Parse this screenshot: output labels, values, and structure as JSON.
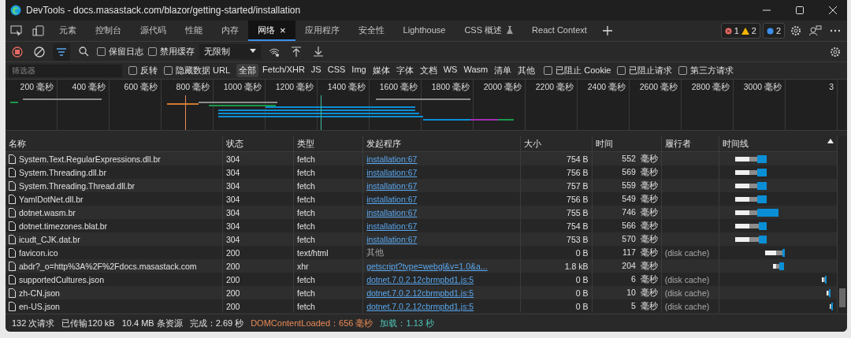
{
  "window": {
    "title": "DevTools - docs.masastack.com/blazor/getting-started/installation"
  },
  "tabs": [
    {
      "label": "元素",
      "selected": false
    },
    {
      "label": "控制台",
      "selected": false
    },
    {
      "label": "源代码",
      "selected": false
    },
    {
      "label": "性能",
      "selected": false
    },
    {
      "label": "内存",
      "selected": false
    },
    {
      "label": "网络",
      "selected": true,
      "close": "×"
    },
    {
      "label": "应用程序",
      "selected": false
    },
    {
      "label": "安全性",
      "selected": false
    },
    {
      "label": "Lighthouse",
      "selected": false
    },
    {
      "label": "CSS 概述",
      "selected": false,
      "experimental": true
    },
    {
      "label": "React Context",
      "selected": false
    }
  ],
  "issues": {
    "errors": "1",
    "warnings": "2",
    "info": "2"
  },
  "toolbar": {
    "recording": true,
    "filter_active": true,
    "preserve_log": {
      "label": "保留日志",
      "checked": false
    },
    "disable_cache": {
      "label": "禁用缓存",
      "checked": false
    },
    "throttle": "无限制"
  },
  "filter_bar": {
    "placeholder": "筛选器",
    "invert": {
      "label": "反转",
      "checked": false
    },
    "hide_data_urls": {
      "label": "隐藏数据 URL",
      "checked": false
    },
    "types": [
      {
        "label": "全部",
        "selected": true
      },
      {
        "label": "Fetch/XHR",
        "selected": false
      },
      {
        "label": "JS",
        "selected": false
      },
      {
        "label": "CSS",
        "selected": false
      },
      {
        "label": "Img",
        "selected": false
      },
      {
        "label": "媒体",
        "selected": false
      },
      {
        "label": "字体",
        "selected": false
      },
      {
        "label": "文档",
        "selected": false
      },
      {
        "label": "WS",
        "selected": false
      },
      {
        "label": "Wasm",
        "selected": false
      },
      {
        "label": "清单",
        "selected": false
      },
      {
        "label": "其他",
        "selected": false
      }
    ],
    "extra": [
      {
        "label": "已阻止 Cookie",
        "checked": false
      },
      {
        "label": "已阻止请求",
        "checked": false
      },
      {
        "label": "第三方请求",
        "checked": false
      }
    ]
  },
  "overview": {
    "ticks": [
      "200 毫秒",
      "400 毫秒",
      "600 毫秒",
      "800 毫秒",
      "1000 毫秒",
      "1200 毫秒",
      "1400 毫秒",
      "1600 毫秒",
      "1800 毫秒",
      "2000 毫秒",
      "2200 毫秒",
      "2400 毫秒",
      "2600 毫秒",
      "2800 毫秒",
      "3000 毫秒",
      "3"
    ]
  },
  "table": {
    "columns": [
      "名称",
      "状态",
      "类型",
      "发起程序",
      "大小",
      "时间",
      "履行者",
      "时间线"
    ],
    "rows": [
      {
        "name": "System.Text.RegularExpressions.dll.br",
        "status": "304",
        "type": "fetch",
        "initiator": "installation:67",
        "initiator_link": true,
        "size": "754 B",
        "time": "552",
        "unit": "毫秒",
        "fulfilled_by": ""
      },
      {
        "name": "System.Threading.dll.br",
        "status": "304",
        "type": "fetch",
        "initiator": "installation:67",
        "initiator_link": true,
        "size": "756 B",
        "time": "569",
        "unit": "毫秒",
        "fulfilled_by": ""
      },
      {
        "name": "System.Threading.Thread.dll.br",
        "status": "304",
        "type": "fetch",
        "initiator": "installation:67",
        "initiator_link": true,
        "size": "757 B",
        "time": "559",
        "unit": "毫秒",
        "fulfilled_by": ""
      },
      {
        "name": "YamlDotNet.dll.br",
        "status": "304",
        "type": "fetch",
        "initiator": "installation:67",
        "initiator_link": true,
        "size": "756 B",
        "time": "549",
        "unit": "毫秒",
        "fulfilled_by": ""
      },
      {
        "name": "dotnet.wasm.br",
        "status": "304",
        "type": "fetch",
        "initiator": "installation:67",
        "initiator_link": true,
        "size": "755 B",
        "time": "746",
        "unit": "毫秒",
        "fulfilled_by": ""
      },
      {
        "name": "dotnet.timezones.blat.br",
        "status": "304",
        "type": "fetch",
        "initiator": "installation:67",
        "initiator_link": true,
        "size": "754 B",
        "time": "566",
        "unit": "毫秒",
        "fulfilled_by": ""
      },
      {
        "name": "icudt_CJK.dat.br",
        "status": "304",
        "type": "fetch",
        "initiator": "installation:67",
        "initiator_link": true,
        "size": "753 B",
        "time": "570",
        "unit": "毫秒",
        "fulfilled_by": ""
      },
      {
        "name": "favicon.ico",
        "status": "200",
        "type": "text/html",
        "initiator": "其他",
        "initiator_link": false,
        "size": "0 B",
        "time": "117",
        "unit": "毫秒",
        "fulfilled_by": "(disk cache)"
      },
      {
        "name": "abdr?_o=http%3A%2F%2Fdocs.masastack.com",
        "status": "200",
        "type": "xhr",
        "initiator": "getscript?type=webgl&v=1.0&a...",
        "initiator_link": true,
        "size": "1.8 kB",
        "time": "204",
        "unit": "毫秒",
        "fulfilled_by": ""
      },
      {
        "name": "supportedCultures.json",
        "status": "200",
        "type": "fetch",
        "initiator": "dotnet.7.0.2.12cbrmpbd1.js:5",
        "initiator_link": true,
        "size": "0 B",
        "time": "6",
        "unit": "毫秒",
        "fulfilled_by": "(disk cache)"
      },
      {
        "name": "zh-CN.json",
        "status": "200",
        "type": "fetch",
        "initiator": "dotnet.7.0.2.12cbrmpbd1.js:5",
        "initiator_link": true,
        "size": "0 B",
        "time": "10",
        "unit": "毫秒",
        "fulfilled_by": "(disk cache)"
      },
      {
        "name": "en-US.json",
        "status": "200",
        "type": "fetch",
        "initiator": "dotnet.7.0.2.12cbrmpbd1.js:5",
        "initiator_link": true,
        "size": "0 B",
        "time": "5",
        "unit": "毫秒",
        "fulfilled_by": "(disk cache)"
      }
    ]
  },
  "status_bar": [
    {
      "kind": "plain",
      "text": "132 次请求"
    },
    {
      "kind": "plain",
      "text": "已传输120 kB"
    },
    {
      "kind": "plain",
      "text": "10.4 MB 条资源"
    },
    {
      "kind": "plain",
      "text": "完成：2.69 秒"
    },
    {
      "kind": "dcl",
      "text": "DOMContentLoaded：656 毫秒"
    },
    {
      "kind": "load",
      "text": "加载：1.13 秒"
    }
  ]
}
